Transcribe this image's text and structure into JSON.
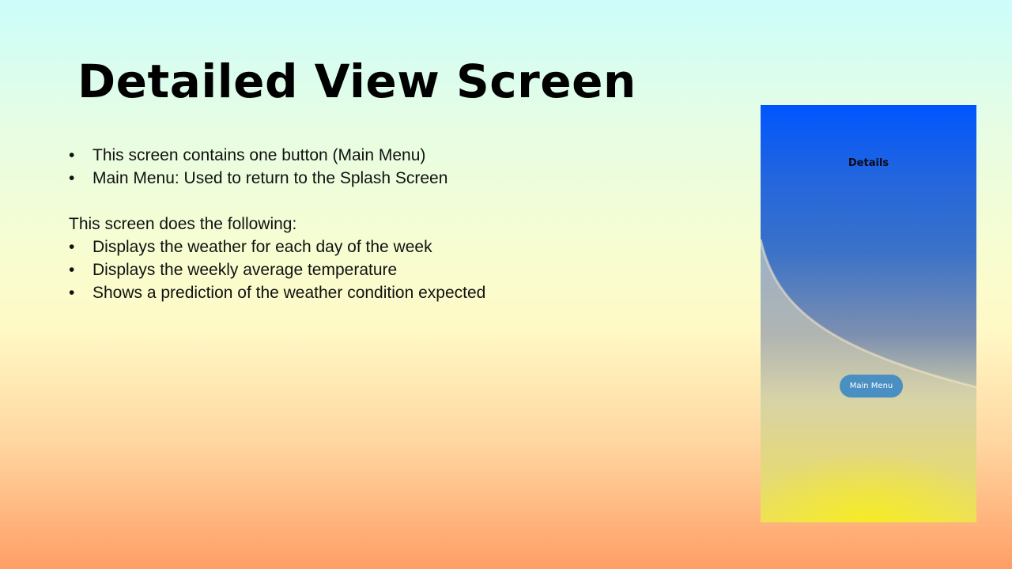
{
  "slide": {
    "title": "Detailed View Screen",
    "bullet_char": "•",
    "bullets_top": [
      "This screen contains one button (Main Menu)",
      "Main Menu: Used to return to the Splash Screen"
    ],
    "intro": "This screen does the following:",
    "bullets_bottom": [
      "Displays the weather for each day of the week",
      "Displays the weekly average temperature",
      "Shows a prediction of the weather condition expected"
    ]
  },
  "phone": {
    "title": "Details",
    "button_label": "Main Menu",
    "colors": {
      "top": "#0055ff",
      "bottom": "#eee24a",
      "button": "#4a8fc2"
    }
  }
}
